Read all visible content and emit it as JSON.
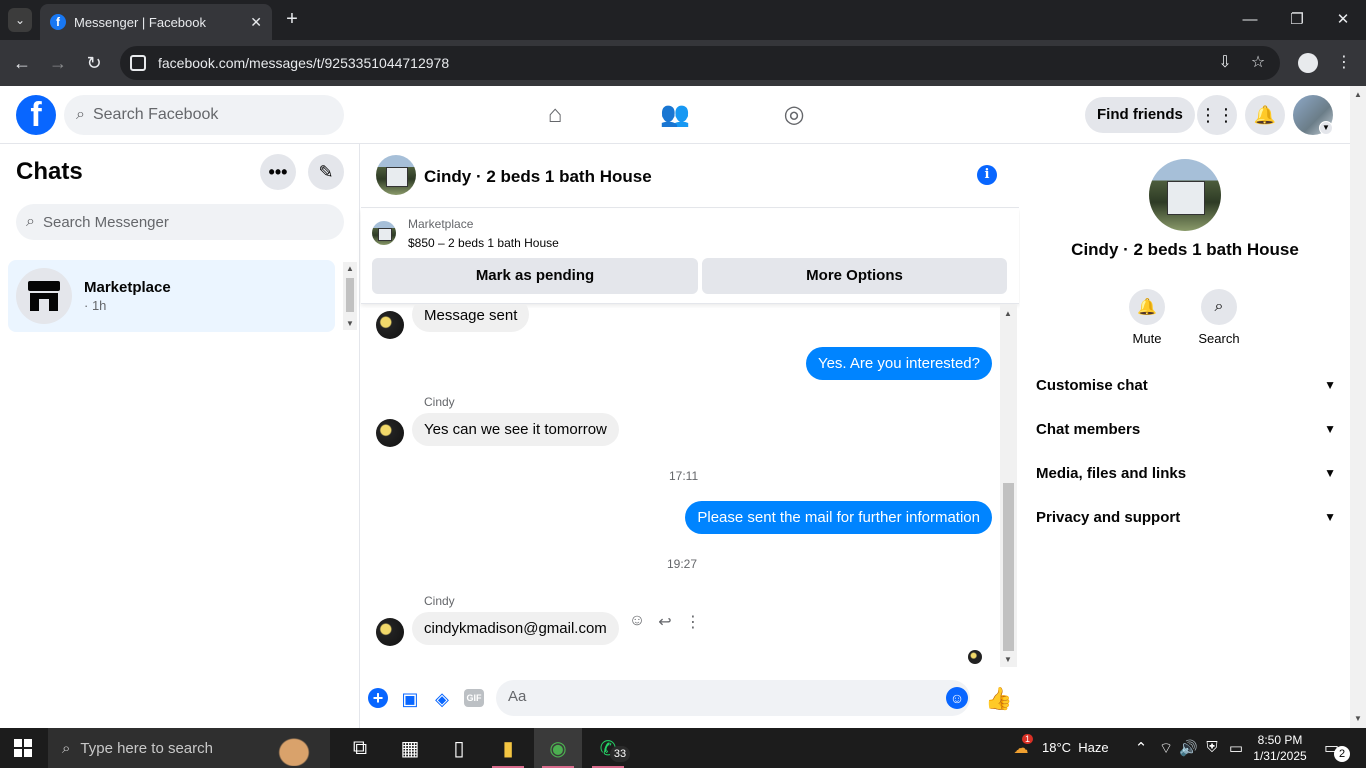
{
  "browser": {
    "tab_title": "Messenger | Facebook",
    "tab_close": "✕",
    "new_tab": "+",
    "url": "facebook.com/messages/t/9253351044712978",
    "minimize": "—",
    "restore": "❐",
    "close": "✕"
  },
  "fb_header": {
    "logo_letter": "f",
    "search_placeholder": "Search Facebook",
    "find_friends": "Find friends"
  },
  "chats": {
    "title": "Chats",
    "more_label": "•••",
    "compose_label": "✎",
    "search_placeholder": "Search Messenger",
    "items": [
      {
        "name": "Marketplace",
        "time": "· 1h"
      }
    ]
  },
  "conversation": {
    "title": "Cindy · 2 beds 1 bath House",
    "info_label": "i",
    "marketplace_label": "Marketplace",
    "listing": "$850 – 2 beds 1 bath House",
    "mark_pending": "Mark as pending",
    "more_options": "More Options",
    "messages": {
      "m1": "Message sent",
      "m2": "Yes. Are you interested?",
      "sender1": "Cindy",
      "m3": "Yes can we see it tomorrow",
      "time1": "17:11",
      "m4": "Please sent the mail for further information",
      "time2": "19:27",
      "sender2": "Cindy",
      "m5": "cindykmadison@gmail.com"
    },
    "composer_placeholder": "Aa",
    "gif_label": "GIF"
  },
  "info_panel": {
    "name": "Cindy · 2 beds 1 bath House",
    "mute_label": "Mute",
    "search_label": "Search",
    "sections": [
      "Customise chat",
      "Chat members",
      "Media, files and links",
      "Privacy and support"
    ]
  },
  "taskbar": {
    "search_placeholder": "Type here to search",
    "whatsapp_badge": "33",
    "weather": "18°C  Haze",
    "weather_badge": "1",
    "time": "8:50 PM",
    "date": "1/31/2025",
    "notifications": "2"
  }
}
